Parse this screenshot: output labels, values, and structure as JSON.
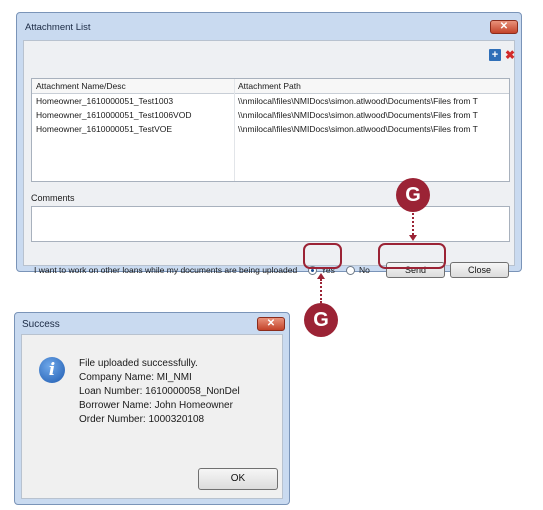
{
  "attachment_window": {
    "title": "Attachment List",
    "close_glyph": "✕",
    "add_glyph": "+",
    "delete_glyph": "✖",
    "columns": [
      "Attachment Name/Desc",
      "Attachment Path"
    ],
    "rows": [
      {
        "name": "Homeowner_1610000051_Test1003",
        "path": "\\\\nmilocal\\files\\NMIDocs\\simon.atlwood\\Documents\\Files from T"
      },
      {
        "name": "Homeowner_1610000051_Test1006VOD",
        "path": "\\\\nmilocal\\files\\NMIDocs\\simon.atlwood\\Documents\\Files from T"
      },
      {
        "name": "Homeowner_1610000051_TestVOE",
        "path": "\\\\nmilocal\\files\\NMIDocs\\simon.atlwood\\Documents\\Files from T"
      }
    ],
    "comments_label": "Comments",
    "comments_value": "",
    "option_prompt": "I want to work on other loans while my documents are being uploaded",
    "option_yes": "Yes",
    "option_no": "No",
    "option_selected": "Yes",
    "send_label": "Send",
    "close_label": "Close"
  },
  "callouts": {
    "top_badge": "G",
    "bottom_badge": "G",
    "color": "#9b2335"
  },
  "success_dialog": {
    "title": "Success",
    "close_glyph": "✕",
    "icon": "info-icon",
    "icon_glyph": "i",
    "lines": [
      "File uploaded successfully.",
      "Company Name: MI_NMI",
      "Loan Number: 1610000058_NonDel",
      "Borrower Name: John Homeowner",
      "Order Number: 1000320108"
    ],
    "ok_label": "OK"
  }
}
